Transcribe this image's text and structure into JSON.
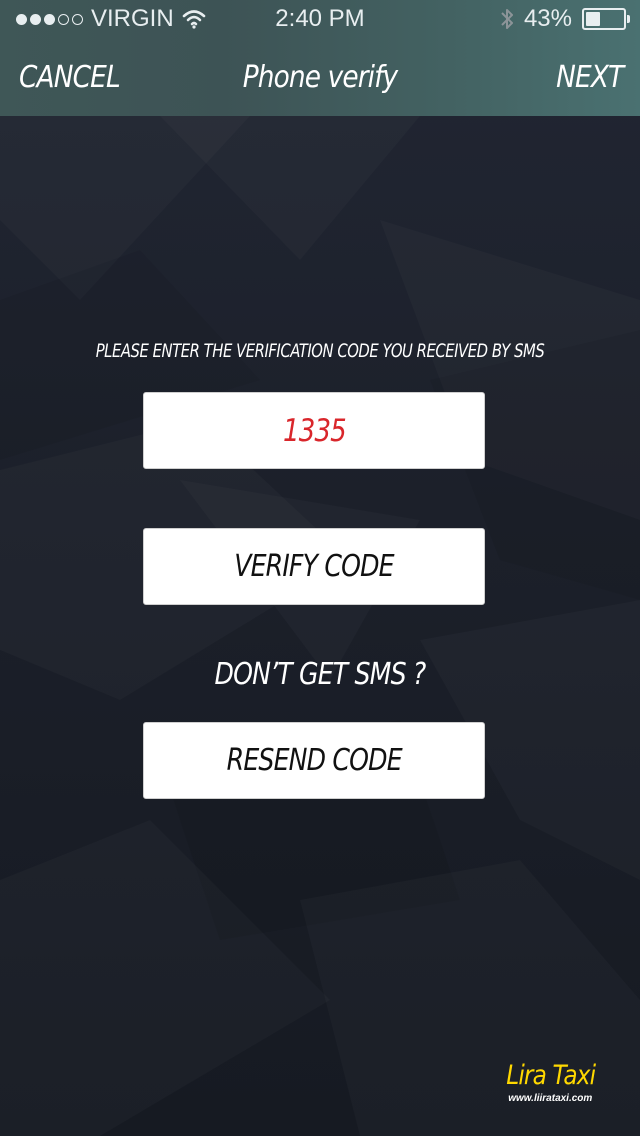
{
  "status_bar": {
    "carrier": "VIRGIN",
    "time": "2:40 PM",
    "battery_percent": "43%",
    "battery_level": 0.43,
    "signal_bars_filled": 3,
    "signal_bars_total": 5,
    "icons": [
      "signal-dots-icon",
      "wifi-icon",
      "bluetooth-icon",
      "battery-icon"
    ]
  },
  "navbar": {
    "cancel_label": "CANCEL",
    "title": "Phone verify",
    "next_label": "NEXT"
  },
  "verification": {
    "instruction": "PLEASE ENTER THE VERIFICATION CODE YOU RECEIVED BY SMS",
    "code_value": "1335",
    "verify_button_label": "VERIFY CODE",
    "no_sms_text": "DON’T GET SMS ?",
    "resend_button_label": "RESEND CODE"
  },
  "logo": {
    "brand": "Lira Taxi",
    "url": "www.liirataxi.com"
  },
  "colors": {
    "navbar_start": "#3f5757",
    "navbar_end": "#4a7171",
    "background": "#1b1f29",
    "code_text": "#d9262b",
    "brand_yellow": "#ffd800"
  }
}
